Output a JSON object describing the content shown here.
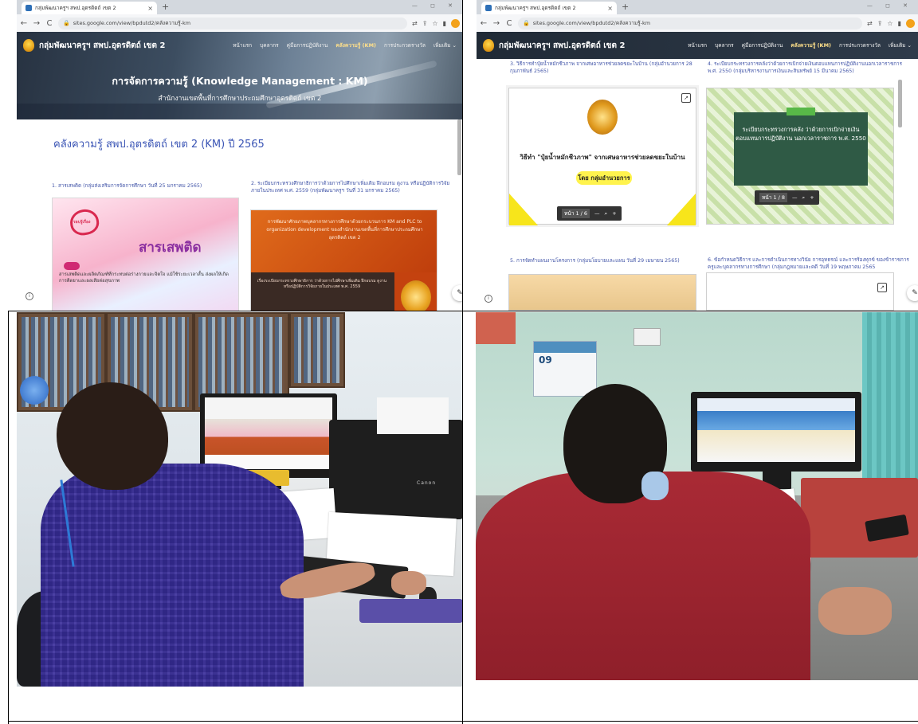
{
  "browser": {
    "tab_title": "กลุ่มพัฒนาครูฯ สพป.อุดรดิตถ์ เขต 2",
    "tab_close": "×",
    "new_tab": "+",
    "url": "sites.google.com/view/bpdutd2/คลังความรู้-km",
    "back": "←",
    "forward": "→",
    "reload": "C"
  },
  "site": {
    "name": "กลุ่มพัฒนาครูฯ สพป.อุดรดิตถ์ เขต 2",
    "nav": [
      "หน้าแรก",
      "บุคลากร",
      "คู่มือการปฏิบัติงาน",
      "คลังความรู้ (KM)",
      "การประกวดรางวัล",
      "เพิ่มเติม ⌄"
    ],
    "active_nav": "คลังความรู้ (KM)"
  },
  "left_page": {
    "hero_title": "การจัดการความรู้ (Knowledge Management : KM)",
    "hero_subtitle": "สำนักงานเขตพื้นที่การศึกษาประถมศึกษาอุตรดิตถ์ เขต 2",
    "heading": "คลังความรู้ สพป.อุตรดิตถ์ เขต 2 (KM) ปี 2565",
    "doc1_caption": "1. สารเสพติด (กลุ่มส่งเสริมการจัดการศึกษา วันที่ 25 มกราคม 2565)",
    "doc2_caption": "2. ระเบียบกระทรวงศึกษาธิการว่าด้วยการไปศึกษาเพิ่มเติม ฝึกอบรม ดูงาน หรือปฏิบัติการวิจัย ภายในประเทศ พ.ศ. 2559 (กลุ่มพัฒนาครูฯ วันที่ 31 มกราคม 2565)",
    "doc1_badge": "รอบรู้เรื่อง",
    "doc1_title": "สารเสพติด",
    "doc1_body": "สารเสพติดและผลิตภัณฑ์ที่กระทบต่อร่างกายและจิตใจ แม้ใช้ระยะเวลาสั้น ส่งผลให้เกิดการติดยาและผลเสียต่อสุขภาพ",
    "doc2_body": "การพัฒนาศักยภาพบุคลากรทางการศึกษาด้วยกระบวนการ KM and PLC to organization development ของสำนักงานเขตพื้นที่การศึกษาประถมศึกษาอุตรดิตถ์ เขต 2",
    "doc2_footer": "เรื่องระเบียบกระทรวงศึกษาธิการ ว่าด้วยการไปศึกษาเพิ่มเติม ฝึกอบรม ดูงาน หรือปฏิบัติการวิจัยภายในประเทศ พ.ศ. 2559"
  },
  "right_page": {
    "doc3_caption": "3. วิธีการทำปุ๋ยน้ำหมักชีวภาพ จากเศษอาหารช่วยลดขยะในบ้าน (กลุ่มอำนวยการ 28 กุมภาพันธ์ 2565)",
    "doc4_caption": "4. ระเบียบกระทรวงการคลังว่าด้วยการเบิกจ่ายเงินตอบแทนการปฏิบัติงานนอกเวลาราชการ พ.ศ. 2550 (กลุ่มบริหารงานการเงินและสินทรัพย์ 15 มีนาคม 2565)",
    "doc5_caption": "5. การจัดทำแผนงานโครงการ (กลุ่มนโยบายและแผน วันที่ 29 เมษายน 2565)",
    "doc6_caption": "6. ข้อกำหนดวิธีการ และการดำเนินการทางวินัย การอุทธรณ์ และการร้องทุกข์ ของข้าราชการครูและบุคลากรทางการศึกษา (กลุ่มกฎหมายและคดี วันที่ 19 พฤษภาคม 2565",
    "doc3_title": "วิธีทำ \"ปุ๋ยน้ำหมักชีวภาพ\" จากเศษอาหารช่วยลดขยะในบ้าน",
    "doc3_author": "โดย กลุ่มอำนวยการ",
    "doc3_pager": "หน้า 1 / 6",
    "doc4_title": "ระเบียบกระทรวงการคลัง ว่าด้วยการเบิกจ่ายเงินตอบแทนการปฏิบัติงาน นอกเวลาราชการ พ.ศ. 2550",
    "doc4_pager": "หน้า 1 / 8",
    "zoom_minus": "—",
    "zoom_plus": "+"
  },
  "photos": {
    "left_printer_brand": "Canon",
    "right_calendar_day": "09"
  },
  "colors": {
    "link_blue": "#4255a8",
    "heading_blue": "#3b55b5",
    "active_nav": "#ffe08a"
  }
}
